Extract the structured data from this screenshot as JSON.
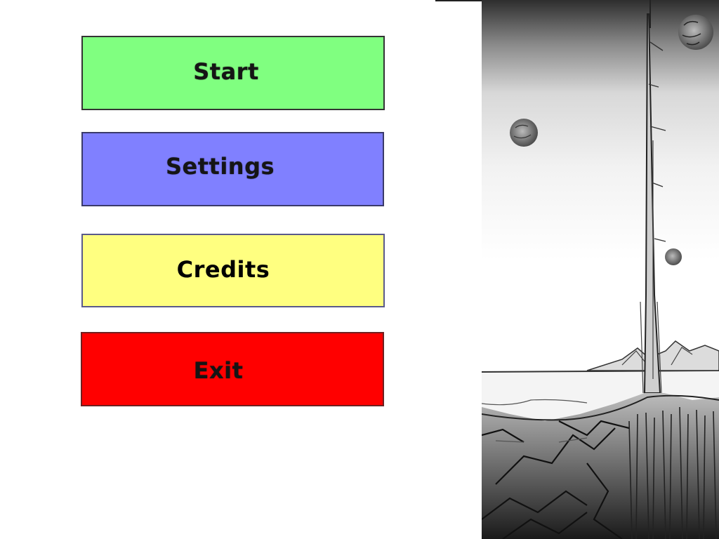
{
  "menu": {
    "buttons": [
      {
        "label": "Start",
        "color": "#80ff80"
      },
      {
        "label": "Settings",
        "color": "#8080ff"
      },
      {
        "label": "Credits",
        "color": "#ffff80"
      },
      {
        "label": "Exit",
        "color": "#ff0000"
      }
    ]
  }
}
